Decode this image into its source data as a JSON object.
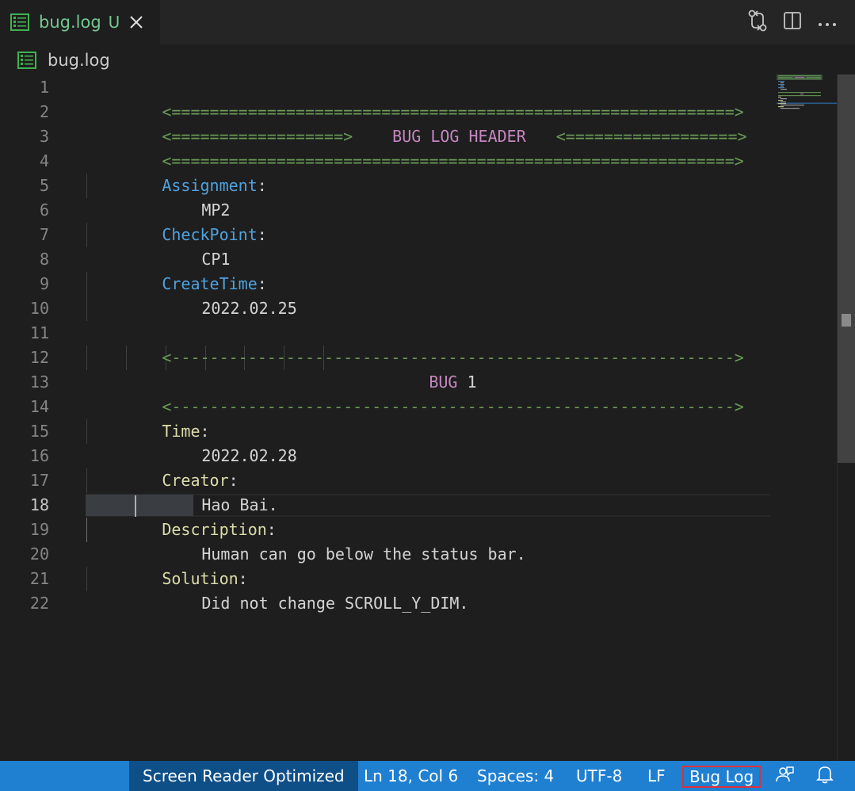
{
  "tab": {
    "label": "bug.log",
    "status": "U",
    "icon": "log-file-icon",
    "close_icon": "close-icon"
  },
  "actions": [
    {
      "name": "open-changes-button",
      "icon": "git-compare-icon"
    },
    {
      "name": "split-editor-button",
      "icon": "split-editor-icon"
    },
    {
      "name": "more-actions-button",
      "icon": "ellipsis-icon"
    }
  ],
  "breadcrumb": {
    "label": "bug.log",
    "icon": "log-file-icon"
  },
  "editor": {
    "active_line": 18,
    "line_numbers": [
      "1",
      "2",
      "3",
      "4",
      "5",
      "6",
      "7",
      "8",
      "9",
      "10",
      "11",
      "12",
      "13",
      "14",
      "15",
      "16",
      "17",
      "18",
      "19",
      "20",
      "21",
      "22"
    ],
    "lines": {
      "l1": "<===========================================================>",
      "l2_left": "<==================>",
      "l2_title": "BUG LOG HEADER",
      "l2_right": "<==================>",
      "l3": "<===========================================================>",
      "l4_key": "Assignment",
      "l5_val": "MP2",
      "l6_key": "CheckPoint",
      "l7_val": "CP1",
      "l8_key": "CreateTime",
      "l9_val": "2022.02.25",
      "l11": "<----------------------------------------------------------->",
      "l12_word": "BUG",
      "l12_num": "1",
      "l13": "<----------------------------------------------------------->",
      "l14_key": "Time",
      "l15_val": "2022.02.28",
      "l16_key": "Creator",
      "l17_val": "Hao Bai.",
      "l18_key": "Description",
      "l19_val": "Human can go below the status bar.",
      "l20_key": "Solution",
      "l21_val": "Did not change SCROLL_Y_DIM.",
      "colon": ":"
    }
  },
  "statusbar": {
    "screen_reader": "Screen Reader Optimized",
    "position": "Ln 18, Col 6",
    "spaces": "Spaces: 4",
    "encoding": "UTF-8",
    "eol": "LF",
    "language": "Bug Log",
    "feedback_icon": "feedback-icon",
    "bell_icon": "bell-icon"
  },
  "colors": {
    "separator": "#6a9955",
    "header": "#c586c0",
    "key_blue": "#4fa3e0",
    "key_yellow": "#dcdcaa",
    "status_bar": "#1f7fd1",
    "tab_label": "#73c991"
  }
}
